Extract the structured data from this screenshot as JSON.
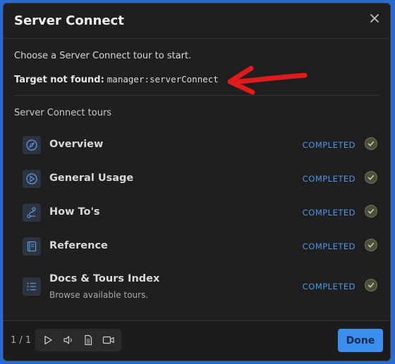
{
  "dialog": {
    "title": "Server Connect",
    "close_icon": "close-icon",
    "intro": "Choose a Server Connect tour to start.",
    "target_label": "Target not found:",
    "target_value": "manager:serverConnect",
    "section_title": "Server Connect tours"
  },
  "tours": [
    {
      "name": "Overview",
      "status": "COMPLETED",
      "icon": "compass-icon"
    },
    {
      "name": "General Usage",
      "status": "COMPLETED",
      "icon": "play-circle-icon"
    },
    {
      "name": "How To's",
      "status": "COMPLETED",
      "icon": "route-icon"
    },
    {
      "name": "Reference",
      "status": "COMPLETED",
      "icon": "book-icon"
    },
    {
      "name": "Docs & Tours Index",
      "subtitle": "Browse available tours.",
      "status": "COMPLETED",
      "icon": "list-icon"
    }
  ],
  "footer": {
    "pager": "1 / 1",
    "done_label": "Done"
  },
  "colors": {
    "accent": "#3a8fef",
    "status": "#4f97e6",
    "arrow": "#e01b1b"
  }
}
